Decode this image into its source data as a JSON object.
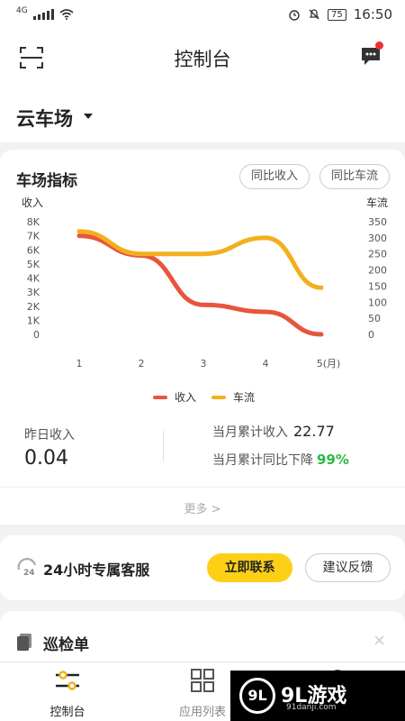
{
  "status_bar": {
    "network": "4G",
    "battery": "75",
    "time": "16:50"
  },
  "header": {
    "title": "控制台"
  },
  "lot": {
    "name": "云车场"
  },
  "indicators_card": {
    "title": "车场指标",
    "btn_revenue_compare": "同比收入",
    "btn_traffic_compare": "同比车流",
    "more_label": "更多 >"
  },
  "chart_data": {
    "type": "line",
    "categories": [
      "1",
      "2",
      "3",
      "4",
      "5(月)"
    ],
    "y_left_label": "收入",
    "y_right_label": "车流",
    "y_left_ticks": [
      "8K",
      "7K",
      "6K",
      "5K",
      "4K",
      "3K",
      "2K",
      "1K",
      "0"
    ],
    "y_right_ticks": [
      "350",
      "300",
      "250",
      "200",
      "150",
      "100",
      "50",
      "0"
    ],
    "y_left_range": [
      0,
      8000
    ],
    "y_right_range": [
      0,
      350
    ],
    "series": [
      {
        "name": "收入",
        "axis": "left",
        "color": "#e8553e",
        "values": [
          7000,
          5600,
          2100,
          1600,
          0
        ]
      },
      {
        "name": "车流",
        "axis": "right",
        "color": "#f2b01e",
        "values": [
          320,
          250,
          250,
          300,
          145
        ]
      }
    ],
    "legend_position": "bottom-center"
  },
  "stats": {
    "yesterday_label": "昨日收入",
    "yesterday_value": "0.04",
    "month_total_label": "当月累计收入",
    "month_total_value": "22.77",
    "month_yoy_label": "当月累计同比下降",
    "month_yoy_value": "99%"
  },
  "service": {
    "badge": "24",
    "title": "24小时专属客服",
    "contact_label": "立即联系",
    "feedback_label": "建议反馈"
  },
  "inspection": {
    "title": "巡检单",
    "close": "×"
  },
  "tabbar": {
    "tabs": [
      {
        "label": "控制台"
      },
      {
        "label": "应用列表"
      },
      {
        "label": ""
      }
    ]
  },
  "watermark": {
    "text": "9L游戏",
    "sub": "91danji.com",
    "logo": "9L"
  }
}
